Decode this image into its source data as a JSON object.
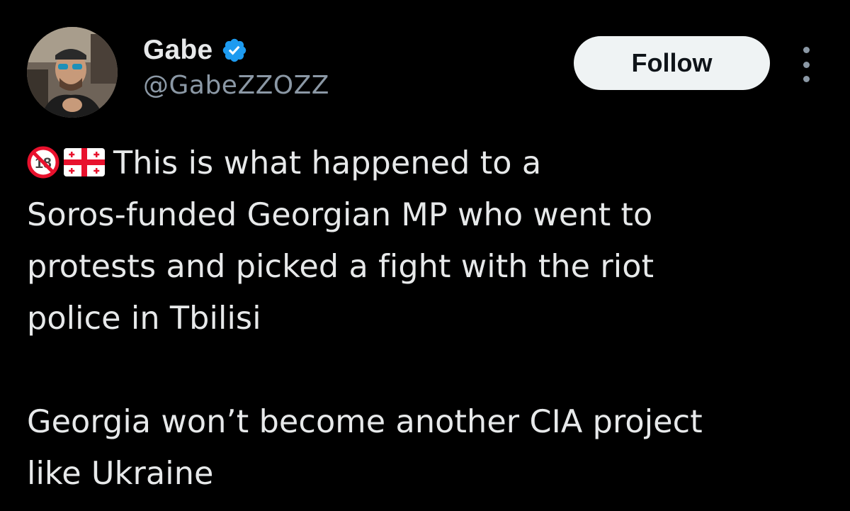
{
  "author": {
    "display_name": "Gabe",
    "handle": "@GabeZZOZZ",
    "verified": true,
    "avatar_icon": "profile-photo"
  },
  "actions": {
    "follow_label": "Follow",
    "more_icon": "more-vertical-icon"
  },
  "tweet": {
    "lead_icons": [
      "no-under-18-icon",
      "georgia-flag-icon"
    ],
    "lines": [
      "This is what happened to a",
      "Soros-funded Georgian MP who went to",
      "protests and picked a fight with the riot",
      "police in Tbilisi"
    ],
    "lines_2": [
      "Georgia won’t become another CIA project",
      "like Ukraine"
    ]
  },
  "colors": {
    "background": "#000000",
    "text_primary": "#e7e9ea",
    "text_secondary": "#8b98a5",
    "verified_blue": "#1d9bf0",
    "follow_bg": "#eff3f4",
    "flag_red": "#e8112d"
  }
}
